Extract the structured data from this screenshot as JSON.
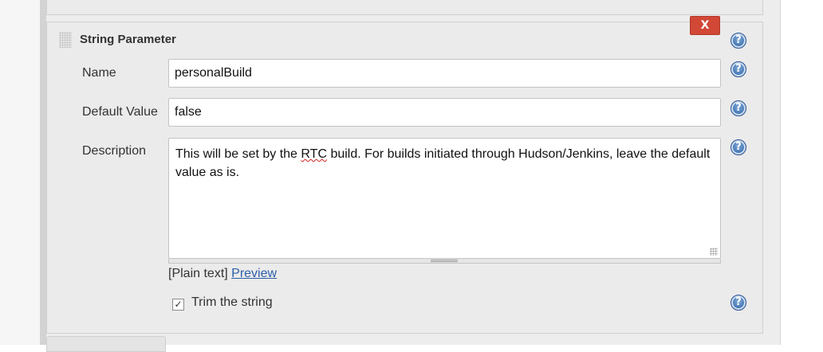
{
  "section": {
    "title": "String Parameter",
    "delete_label": "X"
  },
  "fields": {
    "name_label": "Name",
    "name_value": "personalBuild",
    "default_label": "Default Value",
    "default_value": "false",
    "description_label": "Description",
    "description_pre": "This will be set by the ",
    "description_underlined": "RTC",
    "description_post": " build. For builds initiated through Hudson/Jenkins, leave the default value as is."
  },
  "format": {
    "mode_label": "[Plain text]",
    "preview_label": "Preview"
  },
  "trim": {
    "checked_mark": "✓",
    "label": "Trim the string"
  },
  "help": {
    "glyph": "?"
  }
}
